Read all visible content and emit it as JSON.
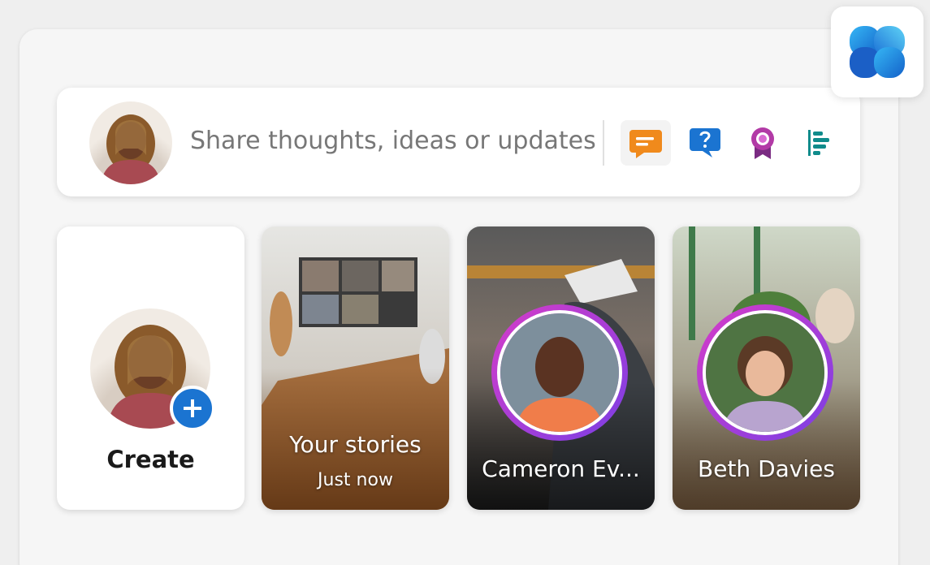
{
  "composer": {
    "placeholder": "Share thoughts, ideas or updates",
    "actions": [
      {
        "name": "discussion-icon",
        "color": "#f08a1c",
        "active": true
      },
      {
        "name": "question-icon",
        "color": "#1b74d1",
        "active": false
      },
      {
        "name": "praise-icon",
        "color": "#a43ba0",
        "active": false
      },
      {
        "name": "poll-icon",
        "color": "#0f8b8b",
        "active": false
      }
    ]
  },
  "stories": {
    "create_label": "Create",
    "items": [
      {
        "title": "Your stories",
        "subtitle": "Just now"
      },
      {
        "title": "Cameron Ev..."
      },
      {
        "title": "Beth Davies"
      }
    ]
  },
  "colors": {
    "accent": "#1b74d1",
    "story_ring_start": "#d63cc8",
    "story_ring_end": "#7b3fe4"
  }
}
